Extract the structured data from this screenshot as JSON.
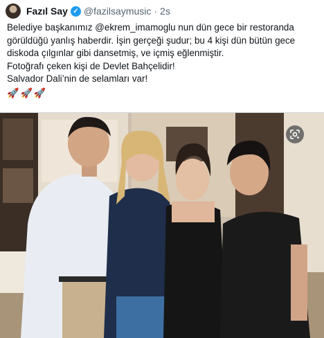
{
  "tweet": {
    "author_name": "Fazıl Say",
    "handle": "@fazilsaymusic",
    "separator": "·",
    "time": "2s",
    "lines": [
      {
        "before": "Belediye başkanımız ",
        "mention": "@ekrem_imamoglu",
        "after": " nun dün gece bir restoranda"
      },
      {
        "text": "görüldüğü yanlış haberdir. İşin gerçeği şudur; bu 4 kişi dün bütün gece"
      },
      {
        "text": "diskoda çılgınlar gibi dansetmiş, ve içmiş eğlenmiştir."
      },
      {
        "text": "Fotoğrafı çeken kişi de Devlet Bahçelidir!"
      },
      {
        "text": "Salvador Dali’nin de selamları var!"
      }
    ],
    "emoji": [
      "🚀",
      "🚀",
      "🚀"
    ]
  },
  "icons": {
    "verified": "verified-badge-icon",
    "lens": "google-lens-icon",
    "rocket": "rocket-icon"
  },
  "colors": {
    "text": "#0f1419",
    "secondary": "#536471",
    "verified": "#1d9bf0"
  }
}
